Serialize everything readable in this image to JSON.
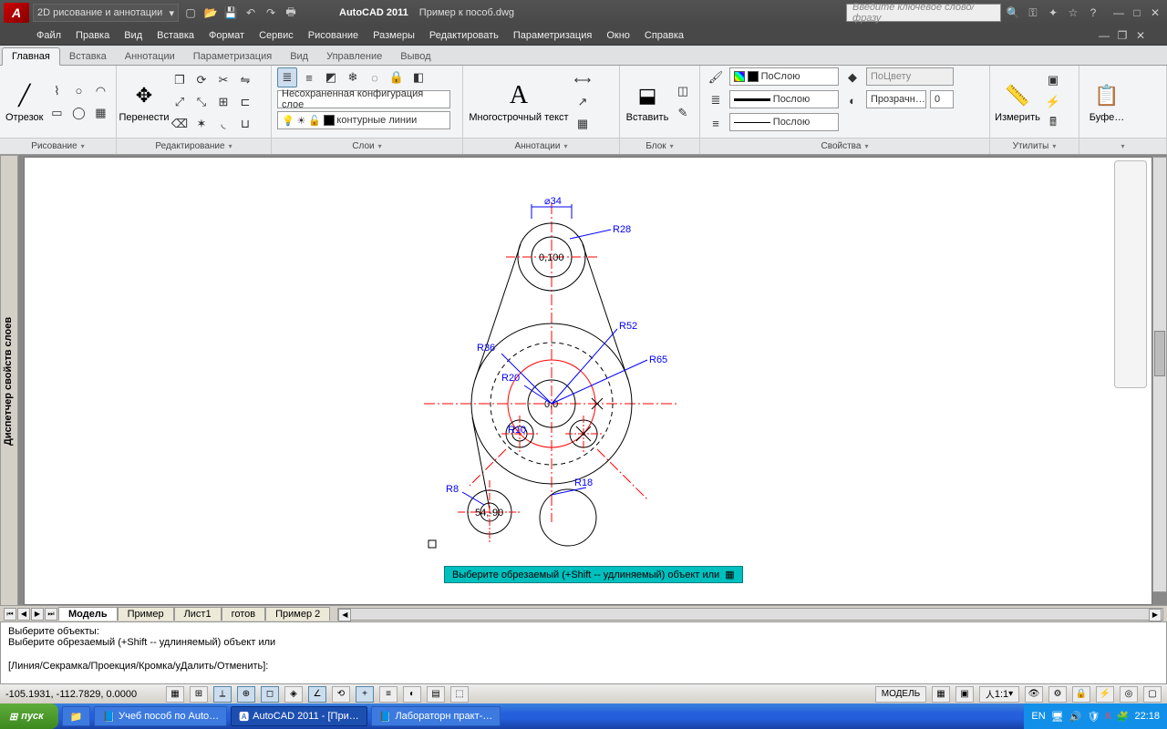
{
  "title": {
    "app": "AutoCAD 2011",
    "file": "Пример к пособ.dwg",
    "workspace": "2D рисование и аннотации",
    "search_placeholder": "Введите ключевое слово/фразу"
  },
  "menu": [
    "Файл",
    "Правка",
    "Вид",
    "Вставка",
    "Формат",
    "Сервис",
    "Рисование",
    "Размеры",
    "Редактировать",
    "Параметризация",
    "Окно",
    "Справка"
  ],
  "ribbon_tabs": [
    "Главная",
    "Вставка",
    "Аннотации",
    "Параметризация",
    "Вид",
    "Управление",
    "Вывод"
  ],
  "panels": {
    "draw": "Рисование",
    "draw_btn": "Отрезок",
    "modify": "Редактирование",
    "modify_btn": "Перенести",
    "layers": "Слои",
    "layer_cfg": "Несохраненная конфигурация слое",
    "layer_combo": "контурные линии",
    "annot": "Аннотации",
    "annot_btn": "Многострочный текст",
    "block": "Блок",
    "block_btn": "Вставить",
    "props": "Свойства",
    "props_layer": "ПоСлою",
    "props_line": "Послою",
    "props_lwt": "Послою",
    "props_color": "ПоЦвету",
    "props_trans_lbl": "Прозрачн…",
    "props_trans_val": "0",
    "util": "Утилиты",
    "util_btn": "Измерить",
    "clip": "Буфе…"
  },
  "model_tabs": [
    "Модель",
    "Пример",
    "Лист1",
    "готов",
    "Пример 2"
  ],
  "cmd": {
    "l1": "Выберите объекты:",
    "l2": "Выберите обрезаемый (+Shift -- удлиняемый) объект или",
    "l3": "[Линия/Секрамка/Проекция/Кромка/уДалить/Отменить]:"
  },
  "hint": "Выберите обрезаемый (+Shift -- удлиняемый) объект или",
  "status": {
    "coords": "-105.1931, -112.7829, 0.0000",
    "model": "МОДЕЛЬ",
    "scale": "1:1"
  },
  "drawing": {
    "d34": "⌀34",
    "r28": "R28",
    "c1": "0,100",
    "r52": "R52",
    "r36": "R36",
    "r65": "R65",
    "r20": "R20",
    "c0": "0,0",
    "r10": "R10",
    "r8": "R8",
    "r18": "R18",
    "c2": "54,-90"
  },
  "sidepanel": "Диспетчер свойств слоев",
  "taskbar": {
    "start": "пуск",
    "t1": "Учеб пособ по Auto…",
    "t2": "AutoCAD 2011 - [При…",
    "t3": "Лабораторн практ-…",
    "lang": "EN",
    "time": "22:18"
  }
}
